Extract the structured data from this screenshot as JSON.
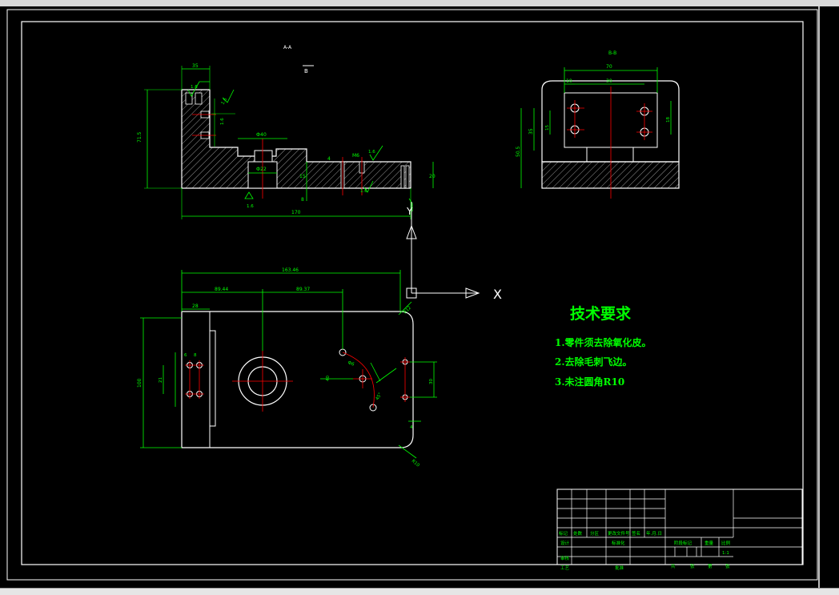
{
  "views": {
    "section_aa_label": "A-A",
    "section_bb_label": "B-B",
    "view_marker": "B"
  },
  "dims_front": {
    "d35": "35",
    "h71": "71.5",
    "w170": "170",
    "d20": "20",
    "dia40": "Ф40",
    "dia22": "Ф22",
    "d15": "15",
    "d8": "8",
    "d4": "4",
    "m6": "M6",
    "ra16a": "1.6",
    "ra16b": "1.6",
    "ra16c": "1.6",
    "ra16d": "1.6",
    "ra16e": "1.6",
    "ra16f": "1.6"
  },
  "dims_side": {
    "d70": "70",
    "d30": "30",
    "d10": "10",
    "d15": "15",
    "d18": "18",
    "h35": "35",
    "h50": "50.5"
  },
  "dims_plan": {
    "d163": "163.46",
    "d89a": "89.44",
    "d89b": "89.37",
    "d28": "28",
    "d100": "100",
    "d40": "40",
    "d21": "21",
    "d6": "6",
    "d8": "8",
    "r12": "R12",
    "r10": "R10",
    "d30": "30",
    "ang": "45°",
    "d4": "4",
    "dia6": "Ф6"
  },
  "axis": {
    "x_label": "X",
    "y_label": "Y"
  },
  "tech_requirements": {
    "title": "技术要求",
    "items": [
      "1.零件须去除氧化皮。",
      "2.去除毛刺飞边。",
      "3.未注圆角R10"
    ]
  },
  "title_block": {
    "labels": [
      "标记",
      "处数",
      "分区",
      "更改文件号",
      "签名",
      "年.月.日"
    ],
    "design": "设计",
    "standard": "标准化",
    "stage": "阶段标记",
    "weight": "重量",
    "scale_label": "比例",
    "scale": "1:1",
    "review": "审核",
    "process": "工艺",
    "approve": "批准",
    "sheets": "共",
    "zhang": "张",
    "di": "第",
    "zhang2": "张"
  },
  "colors": {
    "background": "#000000",
    "outline": "#ffffff",
    "dimension": "#00ff00",
    "centerline": "#ff0000",
    "roughness": "#ffff00"
  }
}
